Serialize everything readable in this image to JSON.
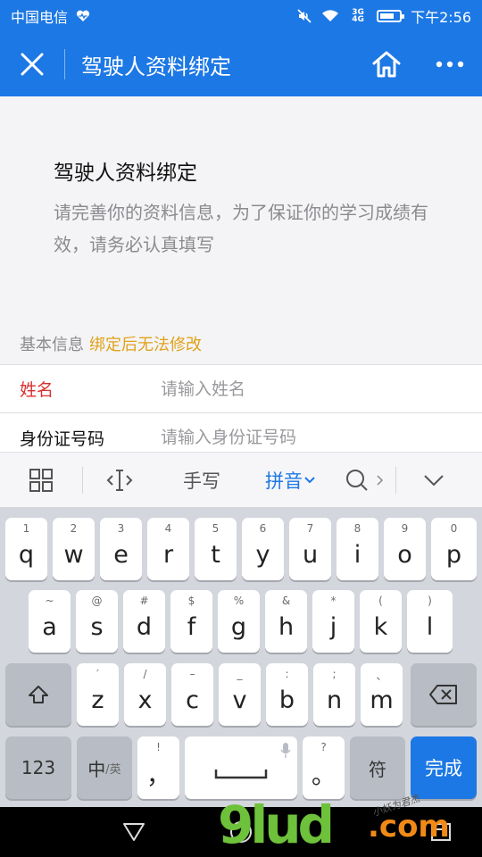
{
  "status_bar": {
    "carrier": "中国电信",
    "time": "下午2:56",
    "data_label_top": "3G",
    "data_label_bottom": "4G",
    "battery_level": 0.75,
    "color": "#1c78e4"
  },
  "nav": {
    "title": "驾驶人资料绑定",
    "icons": {
      "close": "close-icon",
      "home": "home-icon",
      "more": "more-icon"
    }
  },
  "intro": {
    "title": "驾驶人资料绑定",
    "description": "请完善你的资料信息，为了保证你的学习成绩有效，请务必认真填写"
  },
  "section": {
    "label": "基本信息",
    "warning": "绑定后无法修改",
    "warning_color": "#e0a21a"
  },
  "form": {
    "fields": [
      {
        "label": "姓名",
        "placeholder": "请输入姓名",
        "value": "",
        "required": true
      },
      {
        "label": "身份证号码",
        "placeholder": "请输入身份证号码",
        "value": "",
        "required": false
      }
    ]
  },
  "ime_toolbar": {
    "handwrite": "手写",
    "pinyin": "拼音",
    "icons": [
      "grid-icon",
      "cursor-icon",
      "search-icon",
      "collapse-icon"
    ]
  },
  "keyboard": {
    "row1": [
      {
        "sub": "1",
        "key": "q"
      },
      {
        "sub": "2",
        "key": "w"
      },
      {
        "sub": "3",
        "key": "e"
      },
      {
        "sub": "4",
        "key": "r"
      },
      {
        "sub": "5",
        "key": "t"
      },
      {
        "sub": "6",
        "key": "y"
      },
      {
        "sub": "7",
        "key": "u"
      },
      {
        "sub": "8",
        "key": "i"
      },
      {
        "sub": "9",
        "key": "o"
      },
      {
        "sub": "0",
        "key": "p"
      }
    ],
    "row2": [
      {
        "sub": "~",
        "key": "a"
      },
      {
        "sub": "@",
        "key": "s"
      },
      {
        "sub": "#",
        "key": "d"
      },
      {
        "sub": "$",
        "key": "f"
      },
      {
        "sub": "%",
        "key": "g"
      },
      {
        "sub": "&",
        "key": "h"
      },
      {
        "sub": "*",
        "key": "j"
      },
      {
        "sub": "(",
        "key": "k"
      },
      {
        "sub": ")",
        "key": "l"
      }
    ],
    "row3": [
      {
        "sub": "′",
        "key": "z"
      },
      {
        "sub": "/",
        "key": "x"
      },
      {
        "sub": "–",
        "key": "c"
      },
      {
        "sub": "_",
        "key": "v"
      },
      {
        "sub": ":",
        "key": "b"
      },
      {
        "sub": ";",
        "key": "n"
      },
      {
        "sub": "、",
        "key": "m"
      }
    ],
    "num_key": "123",
    "lang_key": "中",
    "lang_key_sub": "/英",
    "comma_key": "，",
    "comma_sub": "!",
    "period_key": "。",
    "period_sub": "?",
    "symbol_key": "符",
    "done_key": "完成"
  },
  "watermark": {
    "logo": "9lud",
    "suffix": ".com",
    "script": "小妖为君杰"
  }
}
